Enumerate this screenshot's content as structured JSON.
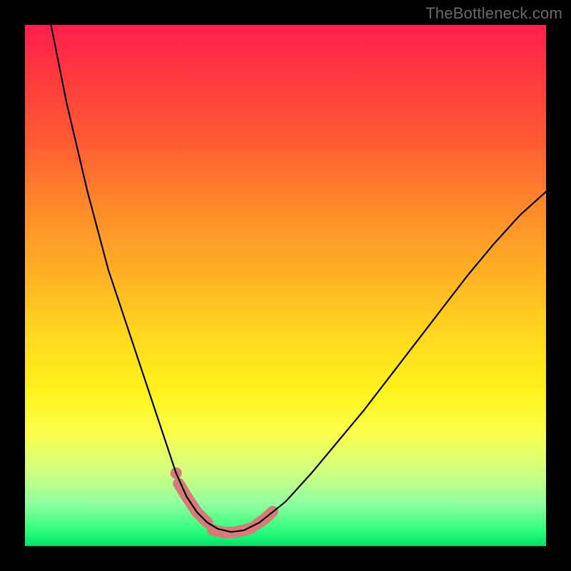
{
  "watermark": "TheBottleneck.com",
  "chart_data": {
    "type": "line",
    "title": "",
    "xlabel": "",
    "ylabel": "",
    "xlim": [
      0,
      100
    ],
    "ylim": [
      0,
      100
    ],
    "grid": false,
    "legend": false,
    "background_gradient": [
      "#ff1e4b",
      "#ff8a2a",
      "#fff21a",
      "#00e26a"
    ],
    "series": [
      {
        "name": "curve",
        "x": [
          5,
          8,
          12,
          16,
          20,
          24,
          27,
          29,
          31,
          33,
          35,
          37,
          39.5,
          42,
          45,
          50,
          55,
          60,
          65,
          70,
          75,
          80,
          85,
          90,
          95,
          100
        ],
        "y": [
          100,
          85,
          68,
          53,
          41,
          29,
          20,
          14,
          9.5,
          6.5,
          4.5,
          3.3,
          2.7,
          3.0,
          4.5,
          8.5,
          14,
          20,
          26,
          32.5,
          39,
          45.5,
          52,
          58,
          63.5,
          68
        ]
      }
    ],
    "highlights": {
      "dot": {
        "x": 29,
        "y": 14
      },
      "segment_left": {
        "x": [
          29.5,
          31,
          33,
          35
        ],
        "y": [
          12,
          9.5,
          6.5,
          4.5
        ]
      },
      "segment_floor": {
        "x": [
          36,
          38,
          40,
          42,
          43.5
        ],
        "y": [
          3.1,
          2.6,
          2.6,
          3.0,
          3.5
        ]
      },
      "segment_right": {
        "x": [
          44.5,
          46,
          47.5
        ],
        "y": [
          4.2,
          5.2,
          6.6
        ]
      }
    }
  }
}
